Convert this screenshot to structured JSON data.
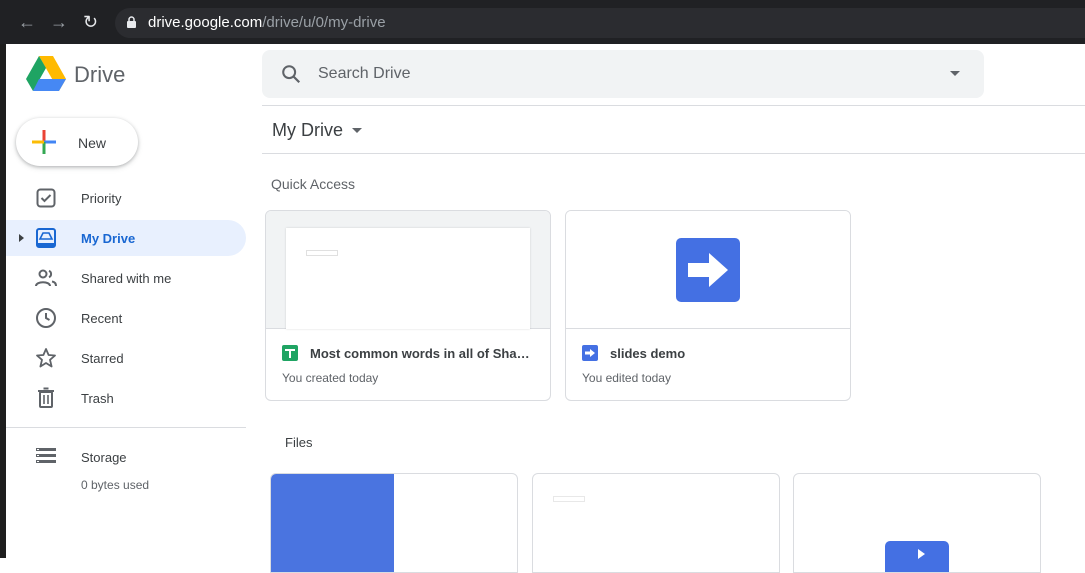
{
  "browser": {
    "url_host": "drive.google.com",
    "url_path": "/drive/u/0/my-drive"
  },
  "app": {
    "brand": "Drive",
    "search_placeholder": "Search Drive",
    "new_label": "New"
  },
  "sidebar": {
    "items": [
      {
        "label": "Priority",
        "icon": "priority-icon"
      },
      {
        "label": "My Drive",
        "icon": "my-drive-icon",
        "active": true
      },
      {
        "label": "Shared with me",
        "icon": "shared-icon"
      },
      {
        "label": "Recent",
        "icon": "clock-icon"
      },
      {
        "label": "Starred",
        "icon": "star-icon"
      },
      {
        "label": "Trash",
        "icon": "trash-icon"
      }
    ],
    "storage_label": "Storage",
    "storage_used": "0 bytes used"
  },
  "main": {
    "title": "My Drive",
    "quick_access_title": "Quick Access",
    "quick_access": [
      {
        "name": "Most common words in all of Shakespeare",
        "subtitle": "You created today",
        "type": "sheets"
      },
      {
        "name": "slides demo",
        "subtitle": "You edited today",
        "type": "slides"
      }
    ],
    "files_title": "Files"
  },
  "colors": {
    "accent": "#1967d2",
    "active_bg": "#e8f0fe",
    "sheets": "#1fa463",
    "slides": "#4470e3",
    "folder_blue": "#4a74e0"
  }
}
